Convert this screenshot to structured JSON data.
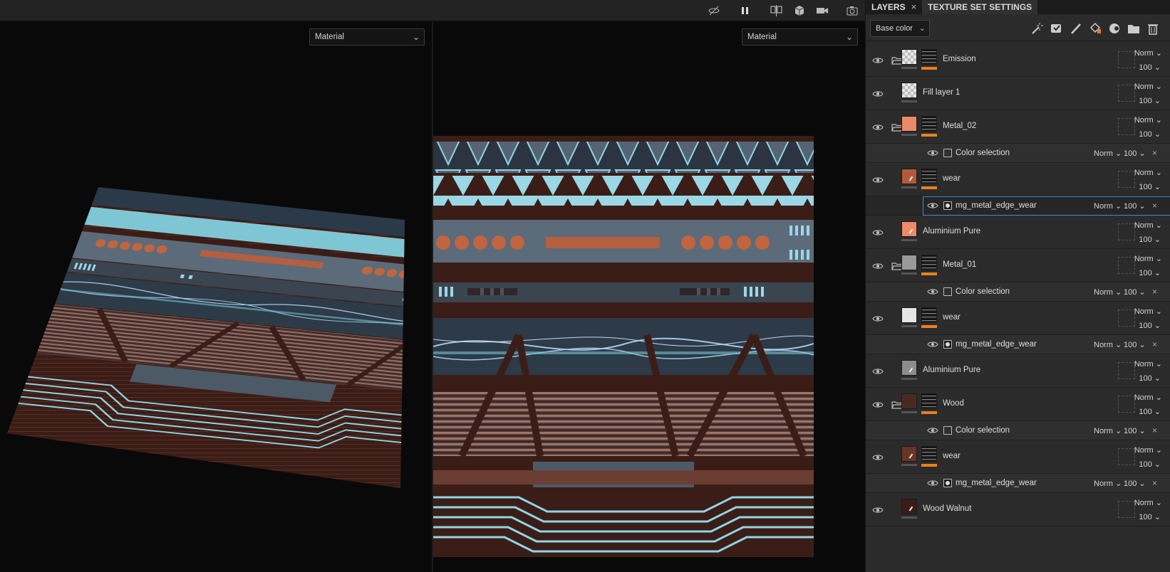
{
  "viewport": {
    "left_channel": "Material",
    "right_channel": "Material"
  },
  "toolbar": {
    "icons": [
      "hide-icon",
      "pause-icon",
      "split-view-icon",
      "cube-icon",
      "camera-icon",
      "screenshot-icon"
    ]
  },
  "panel": {
    "tab_layers": "LAYERS",
    "tab_close": "×",
    "tab_texture_set": "TEXTURE SET SETTINGS",
    "channel": "Base color",
    "chevron": "⌄",
    "tools": [
      "magic-wand-icon",
      "smart-mask-icon",
      "brush-icon",
      "fill-icon",
      "generator-icon",
      "folder-icon",
      "trash-icon"
    ]
  },
  "layers": [
    {
      "kind": "layer",
      "name": "Emission",
      "folder": true,
      "thumb": "checker",
      "mask": true,
      "blend": "Norm ⌄",
      "opacity": "100 ⌄"
    },
    {
      "kind": "layer",
      "name": "Fill layer 1",
      "folder": false,
      "thumb": "checker",
      "mask": false,
      "blend": "Norm ⌄",
      "opacity": "100 ⌄"
    },
    {
      "kind": "layer",
      "name": "Metal_02",
      "folder": true,
      "thumb": "#e98a66",
      "mask": true,
      "blend": "Norm ⌄",
      "opacity": "100 ⌄"
    },
    {
      "kind": "effect",
      "name": "Color selection",
      "icon": "square",
      "blend": "Norm ⌄",
      "opacity": "100 ⌄",
      "close": "×"
    },
    {
      "kind": "layer",
      "name": "wear",
      "folder": false,
      "thumb": "#b35a3e",
      "paint": true,
      "mask": true,
      "blend": "Norm ⌄",
      "opacity": "100 ⌄"
    },
    {
      "kind": "effect",
      "name": "mg_metal_edge_wear",
      "icon": "round",
      "selected": true,
      "blend": "Norm ⌄",
      "opacity": "100 ⌄",
      "close": "×"
    },
    {
      "kind": "layer",
      "name": "Aluminium Pure",
      "folder": false,
      "thumb": "#f0886a",
      "paint": true,
      "mask": false,
      "blend": "Norm ⌄",
      "opacity": "100 ⌄"
    },
    {
      "kind": "layer",
      "name": "Metal_01",
      "folder": true,
      "thumb": "#9a9a9a",
      "mask": true,
      "blend": "Norm ⌄",
      "opacity": "100 ⌄"
    },
    {
      "kind": "effect",
      "name": "Color selection",
      "icon": "square",
      "blend": "Norm ⌄",
      "opacity": "100 ⌄",
      "close": "×"
    },
    {
      "kind": "layer",
      "name": "wear",
      "folder": false,
      "thumb": "#e6e6e6",
      "paint": true,
      "mask": true,
      "blend": "Norm ⌄",
      "opacity": "100 ⌄"
    },
    {
      "kind": "effect",
      "name": "mg_metal_edge_wear",
      "icon": "round",
      "blend": "Norm ⌄",
      "opacity": "100 ⌄",
      "close": "×"
    },
    {
      "kind": "layer",
      "name": "Aluminium Pure",
      "folder": false,
      "thumb": "#8d8d8d",
      "paint": true,
      "mask": false,
      "blend": "Norm ⌄",
      "opacity": "100 ⌄"
    },
    {
      "kind": "layer",
      "name": "Wood",
      "folder": true,
      "thumb": "#4a2a20",
      "mask": true,
      "blend": "Norm ⌄",
      "opacity": "100 ⌄"
    },
    {
      "kind": "effect",
      "name": "Color selection",
      "icon": "square",
      "blend": "Norm ⌄",
      "opacity": "100 ⌄",
      "close": "×"
    },
    {
      "kind": "layer",
      "name": "wear",
      "folder": false,
      "thumb": "#6a3424",
      "paint": true,
      "mask": true,
      "blend": "Norm ⌄",
      "opacity": "100 ⌄"
    },
    {
      "kind": "effect",
      "name": "mg_metal_edge_wear",
      "icon": "round",
      "blend": "Norm ⌄",
      "opacity": "100 ⌄",
      "close": "×"
    },
    {
      "kind": "layer",
      "name": "Wood Walnut",
      "folder": false,
      "thumb": "#3a1c16",
      "paint": true,
      "mask": false,
      "blend": "Norm ⌄",
      "opacity": "100 ⌄"
    }
  ],
  "colors": {
    "accent_blue": "#3d8ad8",
    "mask_orange": "#e8821e",
    "neon": "#8fd6e6",
    "copper": "#b6603f",
    "steel": "#566678"
  }
}
